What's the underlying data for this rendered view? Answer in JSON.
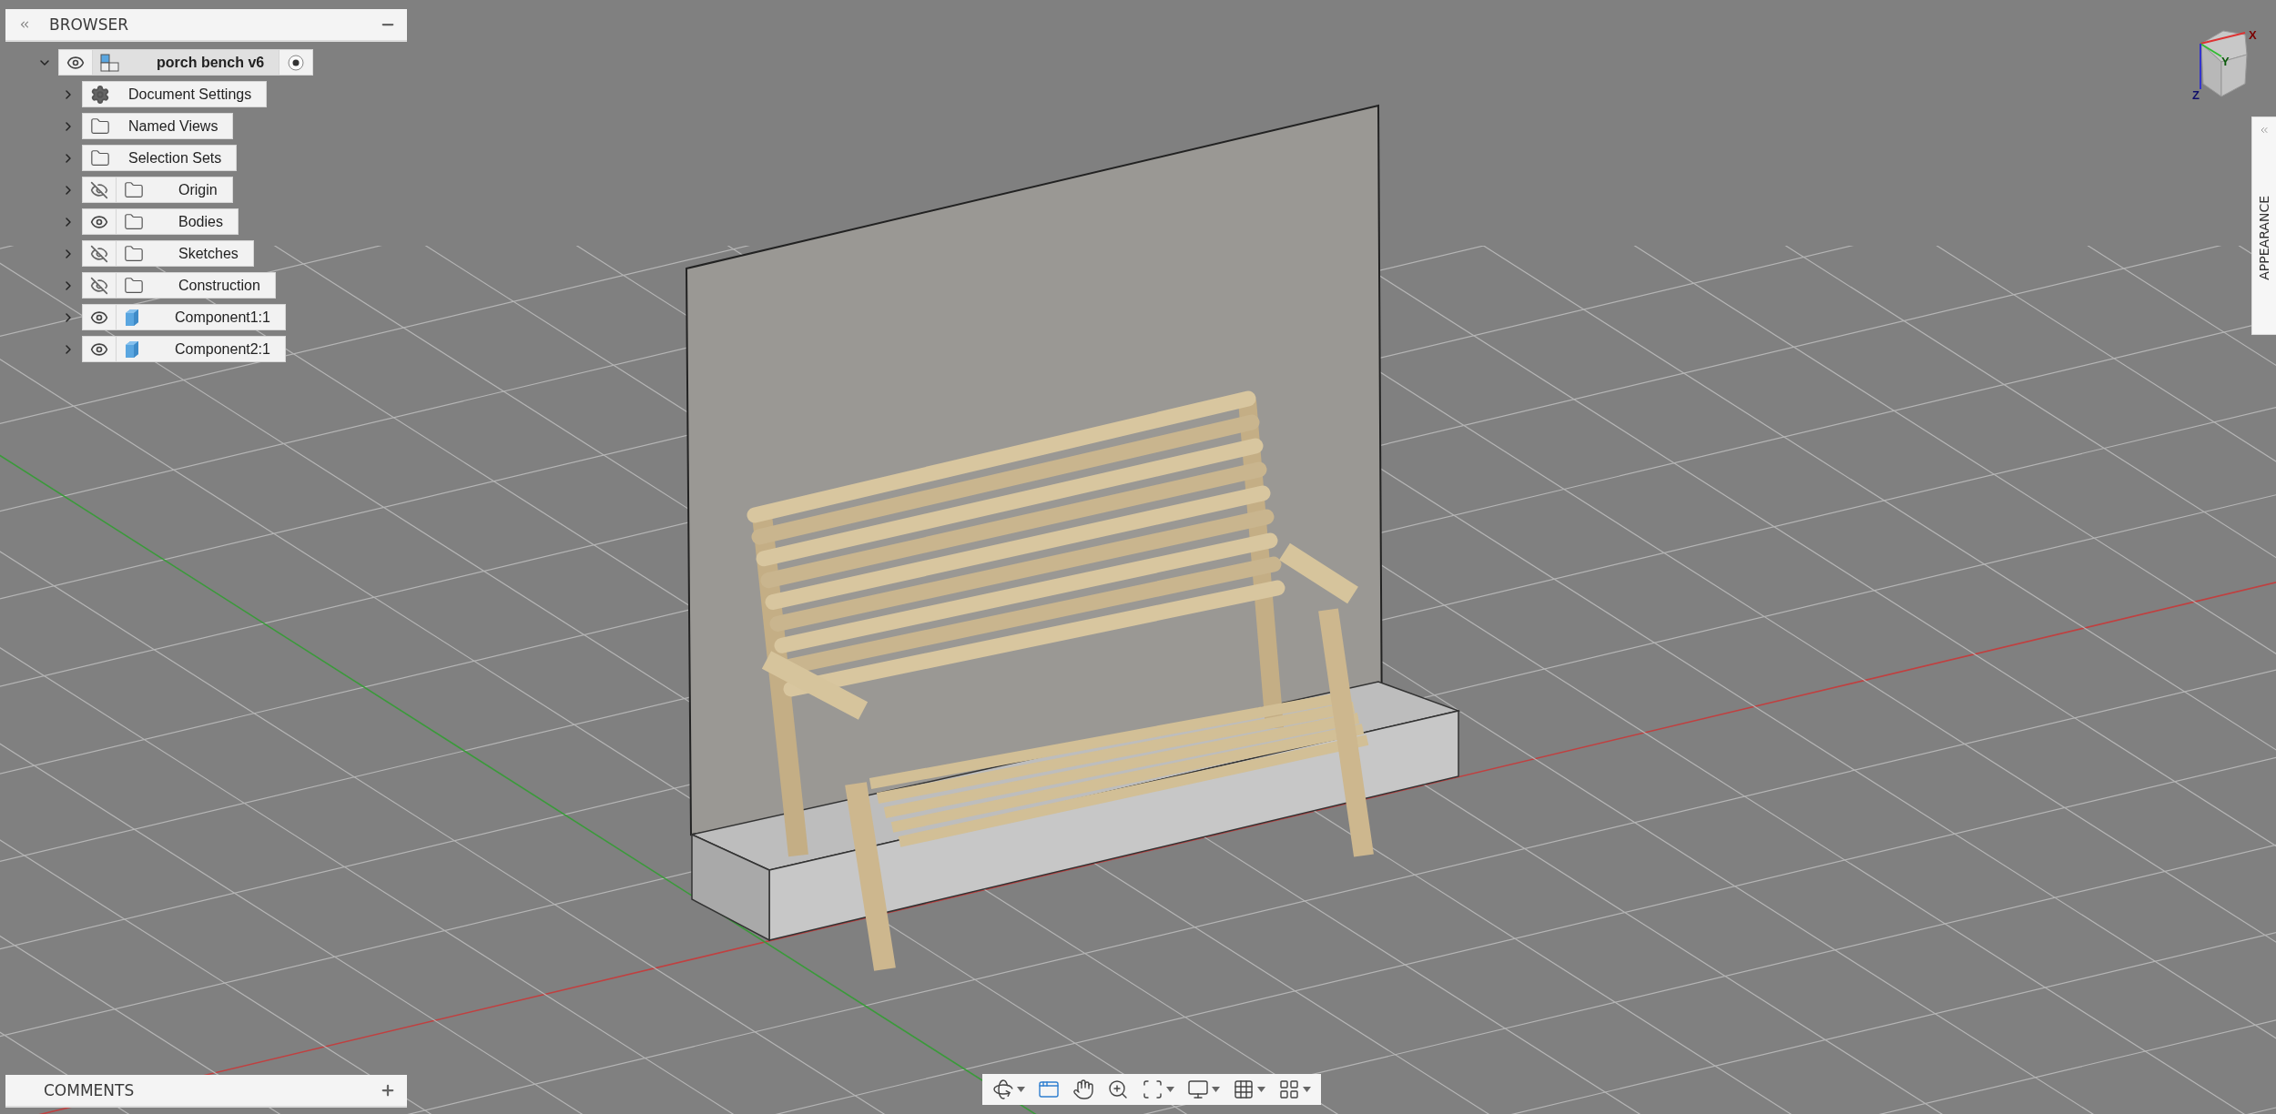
{
  "browser": {
    "title": "BROWSER",
    "root": {
      "label": "porch bench v6",
      "kind": "design",
      "expanded": true,
      "visible": true,
      "active": true,
      "children": [
        {
          "label": "Document Settings",
          "kind": "gear",
          "expanded": false
        },
        {
          "label": "Named Views",
          "kind": "folder",
          "expanded": false
        },
        {
          "label": "Selection Sets",
          "kind": "folder",
          "expanded": false
        },
        {
          "label": "Origin",
          "kind": "folder",
          "expanded": false,
          "visible": false
        },
        {
          "label": "Bodies",
          "kind": "folder",
          "expanded": false,
          "visible": true
        },
        {
          "label": "Sketches",
          "kind": "folder",
          "expanded": false,
          "visible": false
        },
        {
          "label": "Construction",
          "kind": "folder",
          "expanded": false,
          "visible": false
        },
        {
          "label": "Component1:1",
          "kind": "component",
          "expanded": false,
          "visible": true
        },
        {
          "label": "Component2:1",
          "kind": "component",
          "expanded": false,
          "visible": true
        }
      ]
    }
  },
  "view_cube": {
    "axes": [
      "X",
      "Y",
      "Z"
    ]
  },
  "appearance_panel": {
    "title": "APPEARANCE"
  },
  "comments_panel": {
    "title": "COMMENTS"
  },
  "navigation_toolbar": [
    {
      "kind": "orbit",
      "dropdown": true
    },
    {
      "kind": "look_at",
      "dropdown": false
    },
    {
      "kind": "pan",
      "dropdown": false
    },
    {
      "kind": "zoom",
      "dropdown": false
    },
    {
      "kind": "fit",
      "dropdown": true
    },
    {
      "kind": "display",
      "dropdown": true
    },
    {
      "kind": "grid",
      "dropdown": true
    },
    {
      "kind": "viewports",
      "dropdown": true
    }
  ]
}
